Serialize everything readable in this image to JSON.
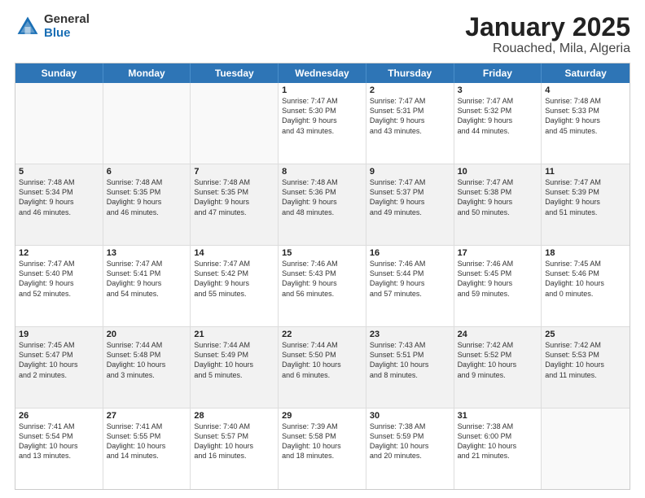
{
  "header": {
    "logo_general": "General",
    "logo_blue": "Blue",
    "title": "January 2025",
    "subtitle": "Rouached, Mila, Algeria"
  },
  "days": [
    "Sunday",
    "Monday",
    "Tuesday",
    "Wednesday",
    "Thursday",
    "Friday",
    "Saturday"
  ],
  "rows": [
    [
      {
        "day": "",
        "empty": true
      },
      {
        "day": "",
        "empty": true
      },
      {
        "day": "",
        "empty": true
      },
      {
        "day": "1",
        "line1": "Sunrise: 7:47 AM",
        "line2": "Sunset: 5:30 PM",
        "line3": "Daylight: 9 hours",
        "line4": "and 43 minutes."
      },
      {
        "day": "2",
        "line1": "Sunrise: 7:47 AM",
        "line2": "Sunset: 5:31 PM",
        "line3": "Daylight: 9 hours",
        "line4": "and 43 minutes."
      },
      {
        "day": "3",
        "line1": "Sunrise: 7:47 AM",
        "line2": "Sunset: 5:32 PM",
        "line3": "Daylight: 9 hours",
        "line4": "and 44 minutes."
      },
      {
        "day": "4",
        "line1": "Sunrise: 7:48 AM",
        "line2": "Sunset: 5:33 PM",
        "line3": "Daylight: 9 hours",
        "line4": "and 45 minutes."
      }
    ],
    [
      {
        "day": "5",
        "line1": "Sunrise: 7:48 AM",
        "line2": "Sunset: 5:34 PM",
        "line3": "Daylight: 9 hours",
        "line4": "and 46 minutes.",
        "shaded": true
      },
      {
        "day": "6",
        "line1": "Sunrise: 7:48 AM",
        "line2": "Sunset: 5:35 PM",
        "line3": "Daylight: 9 hours",
        "line4": "and 46 minutes.",
        "shaded": true
      },
      {
        "day": "7",
        "line1": "Sunrise: 7:48 AM",
        "line2": "Sunset: 5:35 PM",
        "line3": "Daylight: 9 hours",
        "line4": "and 47 minutes.",
        "shaded": true
      },
      {
        "day": "8",
        "line1": "Sunrise: 7:48 AM",
        "line2": "Sunset: 5:36 PM",
        "line3": "Daylight: 9 hours",
        "line4": "and 48 minutes.",
        "shaded": true
      },
      {
        "day": "9",
        "line1": "Sunrise: 7:47 AM",
        "line2": "Sunset: 5:37 PM",
        "line3": "Daylight: 9 hours",
        "line4": "and 49 minutes.",
        "shaded": true
      },
      {
        "day": "10",
        "line1": "Sunrise: 7:47 AM",
        "line2": "Sunset: 5:38 PM",
        "line3": "Daylight: 9 hours",
        "line4": "and 50 minutes.",
        "shaded": true
      },
      {
        "day": "11",
        "line1": "Sunrise: 7:47 AM",
        "line2": "Sunset: 5:39 PM",
        "line3": "Daylight: 9 hours",
        "line4": "and 51 minutes.",
        "shaded": true
      }
    ],
    [
      {
        "day": "12",
        "line1": "Sunrise: 7:47 AM",
        "line2": "Sunset: 5:40 PM",
        "line3": "Daylight: 9 hours",
        "line4": "and 52 minutes."
      },
      {
        "day": "13",
        "line1": "Sunrise: 7:47 AM",
        "line2": "Sunset: 5:41 PM",
        "line3": "Daylight: 9 hours",
        "line4": "and 54 minutes."
      },
      {
        "day": "14",
        "line1": "Sunrise: 7:47 AM",
        "line2": "Sunset: 5:42 PM",
        "line3": "Daylight: 9 hours",
        "line4": "and 55 minutes."
      },
      {
        "day": "15",
        "line1": "Sunrise: 7:46 AM",
        "line2": "Sunset: 5:43 PM",
        "line3": "Daylight: 9 hours",
        "line4": "and 56 minutes."
      },
      {
        "day": "16",
        "line1": "Sunrise: 7:46 AM",
        "line2": "Sunset: 5:44 PM",
        "line3": "Daylight: 9 hours",
        "line4": "and 57 minutes."
      },
      {
        "day": "17",
        "line1": "Sunrise: 7:46 AM",
        "line2": "Sunset: 5:45 PM",
        "line3": "Daylight: 9 hours",
        "line4": "and 59 minutes."
      },
      {
        "day": "18",
        "line1": "Sunrise: 7:45 AM",
        "line2": "Sunset: 5:46 PM",
        "line3": "Daylight: 10 hours",
        "line4": "and 0 minutes."
      }
    ],
    [
      {
        "day": "19",
        "line1": "Sunrise: 7:45 AM",
        "line2": "Sunset: 5:47 PM",
        "line3": "Daylight: 10 hours",
        "line4": "and 2 minutes.",
        "shaded": true
      },
      {
        "day": "20",
        "line1": "Sunrise: 7:44 AM",
        "line2": "Sunset: 5:48 PM",
        "line3": "Daylight: 10 hours",
        "line4": "and 3 minutes.",
        "shaded": true
      },
      {
        "day": "21",
        "line1": "Sunrise: 7:44 AM",
        "line2": "Sunset: 5:49 PM",
        "line3": "Daylight: 10 hours",
        "line4": "and 5 minutes.",
        "shaded": true
      },
      {
        "day": "22",
        "line1": "Sunrise: 7:44 AM",
        "line2": "Sunset: 5:50 PM",
        "line3": "Daylight: 10 hours",
        "line4": "and 6 minutes.",
        "shaded": true
      },
      {
        "day": "23",
        "line1": "Sunrise: 7:43 AM",
        "line2": "Sunset: 5:51 PM",
        "line3": "Daylight: 10 hours",
        "line4": "and 8 minutes.",
        "shaded": true
      },
      {
        "day": "24",
        "line1": "Sunrise: 7:42 AM",
        "line2": "Sunset: 5:52 PM",
        "line3": "Daylight: 10 hours",
        "line4": "and 9 minutes.",
        "shaded": true
      },
      {
        "day": "25",
        "line1": "Sunrise: 7:42 AM",
        "line2": "Sunset: 5:53 PM",
        "line3": "Daylight: 10 hours",
        "line4": "and 11 minutes.",
        "shaded": true
      }
    ],
    [
      {
        "day": "26",
        "line1": "Sunrise: 7:41 AM",
        "line2": "Sunset: 5:54 PM",
        "line3": "Daylight: 10 hours",
        "line4": "and 13 minutes."
      },
      {
        "day": "27",
        "line1": "Sunrise: 7:41 AM",
        "line2": "Sunset: 5:55 PM",
        "line3": "Daylight: 10 hours",
        "line4": "and 14 minutes."
      },
      {
        "day": "28",
        "line1": "Sunrise: 7:40 AM",
        "line2": "Sunset: 5:57 PM",
        "line3": "Daylight: 10 hours",
        "line4": "and 16 minutes."
      },
      {
        "day": "29",
        "line1": "Sunrise: 7:39 AM",
        "line2": "Sunset: 5:58 PM",
        "line3": "Daylight: 10 hours",
        "line4": "and 18 minutes."
      },
      {
        "day": "30",
        "line1": "Sunrise: 7:38 AM",
        "line2": "Sunset: 5:59 PM",
        "line3": "Daylight: 10 hours",
        "line4": "and 20 minutes."
      },
      {
        "day": "31",
        "line1": "Sunrise: 7:38 AM",
        "line2": "Sunset: 6:00 PM",
        "line3": "Daylight: 10 hours",
        "line4": "and 21 minutes."
      },
      {
        "day": "",
        "empty": true
      }
    ]
  ]
}
